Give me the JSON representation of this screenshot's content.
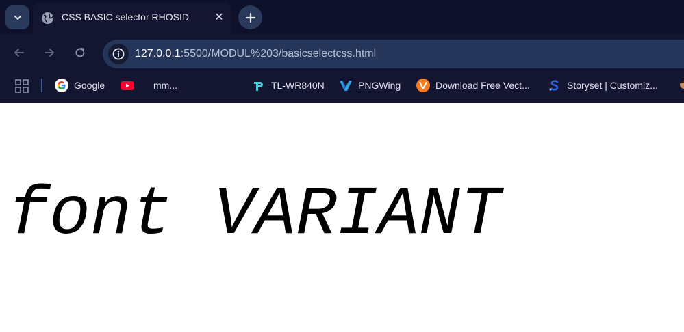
{
  "tab": {
    "title": "CSS BASIC selector RHOSID",
    "close_symbol": "✕",
    "favicon": "globe-icon"
  },
  "toolbar": {
    "url_host": "127.0.0.1",
    "url_rest": ":5500/MODUL%203/basicselectcss.html"
  },
  "bookmarks": [
    {
      "label": "Google",
      "icon": "google-icon"
    },
    {
      "label": "",
      "icon": "youtube-icon"
    },
    {
      "label": "mm...",
      "icon": ""
    },
    {
      "label": "TL-WR840N",
      "icon": "tp-link-icon"
    },
    {
      "label": "PNGWing",
      "icon": "pngwing-icon"
    },
    {
      "label": "Download Free Vect...",
      "icon": "vecteezy-icon"
    },
    {
      "label": "Storyset | Customiz...",
      "icon": "storyset-icon"
    }
  ],
  "page": {
    "text": "font VARIANT"
  },
  "colors": {
    "tabstrip": "#0f1029",
    "toolbar": "#141530",
    "omnibox": "#26355a",
    "youtube": "#ff0033",
    "tplink": "#4acbd6",
    "vecteezy": "#f57c21",
    "storyset": "#2d64e3"
  }
}
